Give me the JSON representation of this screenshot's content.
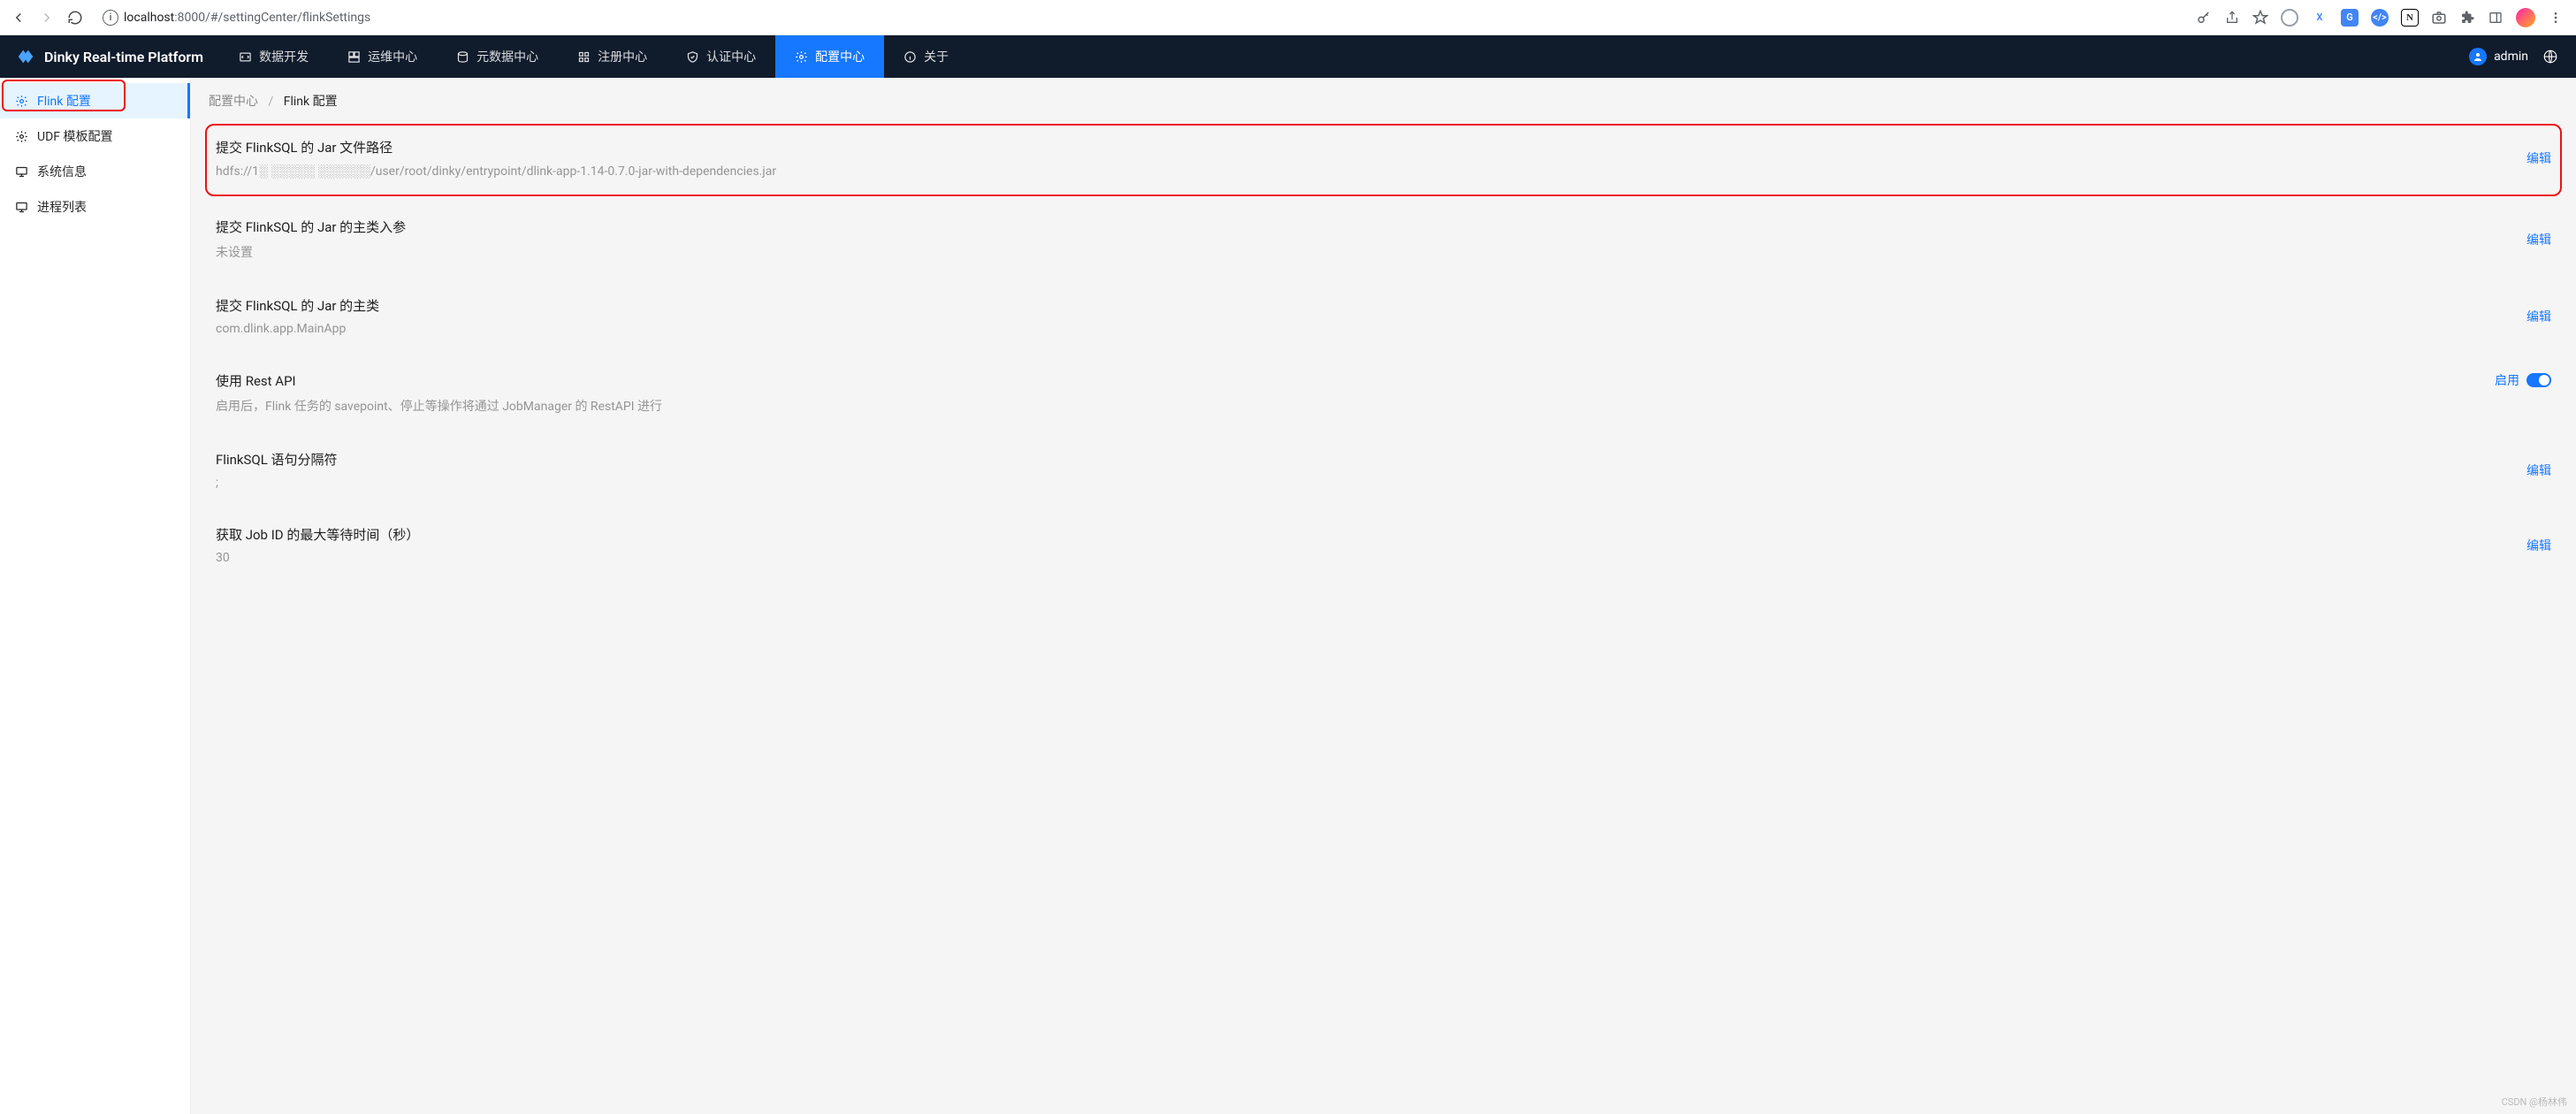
{
  "browser": {
    "url_host": "localhost",
    "url_port": ":8000",
    "url_path": "/#/settingCenter/flinkSettings"
  },
  "brand": {
    "title": "Dinky Real-time Platform"
  },
  "topnav": {
    "items": [
      {
        "label": "数据开发",
        "icon": "code-icon"
      },
      {
        "label": "运维中心",
        "icon": "dashboard-icon"
      },
      {
        "label": "元数据中心",
        "icon": "database-icon"
      },
      {
        "label": "注册中心",
        "icon": "grid-icon"
      },
      {
        "label": "认证中心",
        "icon": "shield-icon"
      },
      {
        "label": "配置中心",
        "icon": "gear-icon",
        "active": true
      },
      {
        "label": "关于",
        "icon": "info-icon"
      }
    ]
  },
  "user": {
    "name": "admin"
  },
  "sidebar": {
    "items": [
      {
        "label": "Flink 配置",
        "icon": "gear-icon",
        "active": true
      },
      {
        "label": "UDF 模板配置",
        "icon": "gear-icon"
      },
      {
        "label": "系统信息",
        "icon": "monitor-icon"
      },
      {
        "label": "进程列表",
        "icon": "monitor-icon"
      }
    ]
  },
  "breadcrumb": {
    "root": "配置中心",
    "current": "Flink 配置"
  },
  "settings": {
    "rows": [
      {
        "title": "提交 FlinkSQL 的 Jar 文件路径",
        "value": "hdfs://1░ ░░░░░ ░░░░░░/user/root/dinky/entrypoint/dlink-app-1.14-0.7.0-jar-with-dependencies.jar",
        "action": "编辑",
        "highlighted": true
      },
      {
        "title": "提交 FlinkSQL 的 Jar 的主类入参",
        "value": "未设置",
        "action": "编辑"
      },
      {
        "title": "提交 FlinkSQL 的 Jar 的主类",
        "value": "com.dlink.app.MainApp",
        "action": "编辑"
      },
      {
        "title": "使用 Rest API",
        "value": "启用后，Flink 任务的 savepoint、停止等操作将通过 JobManager 的 RestAPI 进行",
        "action": "启用",
        "toggle": true
      },
      {
        "title": "FlinkSQL 语句分隔符",
        "value": ";",
        "action": "编辑"
      },
      {
        "title": "获取 Job ID 的最大等待时间（秒）",
        "value": "30",
        "action": "编辑"
      }
    ]
  },
  "watermark": "CSDN @杨林伟"
}
